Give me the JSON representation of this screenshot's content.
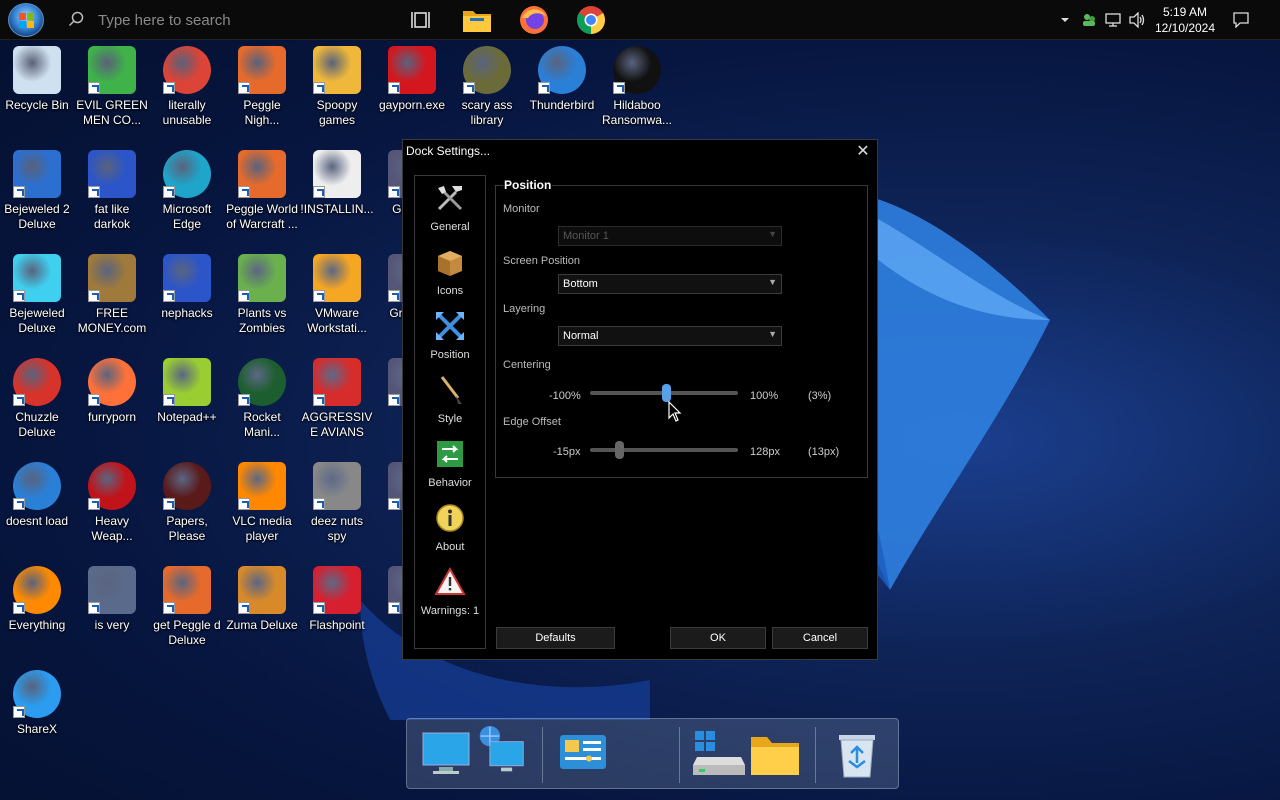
{
  "taskbar": {
    "search_placeholder": "Type here to search",
    "pinned": [
      "task-view-icon",
      "file-explorer-icon",
      "firefox-icon",
      "chrome-icon"
    ],
    "clock_time": "5:19 AM",
    "clock_date": "12/10/2024"
  },
  "desktop": {
    "icons": [
      {
        "label": "Recycle Bin",
        "icon": "recycle-bin-icon"
      },
      {
        "label": "EVIL GREEN MEN CO...",
        "icon": "messenger-icon"
      },
      {
        "label": "literally unusable",
        "icon": "chrome-icon"
      },
      {
        "label": "Peggle Nigh...",
        "icon": "peggle-icon"
      },
      {
        "label": "Spoopy games",
        "icon": "folder-icon"
      },
      {
        "label": "gayporn.exe",
        "icon": "flash-icon"
      },
      {
        "label": "scary ass library",
        "icon": "library-icon"
      },
      {
        "label": "Thunderbird",
        "icon": "thunderbird-icon"
      },
      {
        "label": "Hildaboo Ransomwa...",
        "icon": "yashma-icon"
      },
      {
        "label": "Bejeweled 2 Deluxe",
        "icon": "bejeweled2-icon"
      },
      {
        "label": "fat like darkok",
        "icon": "mpi-icon"
      },
      {
        "label": "Microsoft Edge",
        "icon": "edge-icon"
      },
      {
        "label": "Peggle World of Warcraft ...",
        "icon": "peggle-icon"
      },
      {
        "label": "!INSTALLIN...",
        "icon": "text-file-icon"
      },
      {
        "label": "GI THE",
        "icon": "partial-icon"
      },
      {
        "label": "Bejeweled Deluxe",
        "icon": "diamond-icon"
      },
      {
        "label": "FREE MONEY.com",
        "icon": "money-bag-icon"
      },
      {
        "label": "nephacks",
        "icon": "mpi-icon"
      },
      {
        "label": "Plants vs Zombies",
        "icon": "pvz-icon"
      },
      {
        "label": "VMware Workstati...",
        "icon": "vmware-icon"
      },
      {
        "label": "Gra Part",
        "icon": "partial-icon"
      },
      {
        "label": "Chuzzle Deluxe",
        "icon": "chuzzle-icon"
      },
      {
        "label": "furryporn",
        "icon": "firefox-icon"
      },
      {
        "label": "Notepad++",
        "icon": "notepadpp-icon"
      },
      {
        "label": "Rocket Mani...",
        "icon": "rocket-icon"
      },
      {
        "label": "AGGRESSIVE AVIANS",
        "icon": "angry-birds-icon"
      },
      {
        "label": "Hal",
        "icon": "partial-icon"
      },
      {
        "label": "doesnt load",
        "icon": "thunderbird-icon"
      },
      {
        "label": "Heavy Weap...",
        "icon": "radiation-icon"
      },
      {
        "label": "Papers, Please",
        "icon": "papers-please-icon"
      },
      {
        "label": "VLC media player",
        "icon": "vlc-icon"
      },
      {
        "label": "deez nuts spy",
        "icon": "copies-icon"
      },
      {
        "label": "Ba",
        "icon": "partial-icon"
      },
      {
        "label": "Everything",
        "icon": "search-ring-icon"
      },
      {
        "label": "is very",
        "icon": "mpi-shield-icon"
      },
      {
        "label": "get Peggle d Deluxe",
        "icon": "peggle-icon"
      },
      {
        "label": "Zuma Deluxe",
        "icon": "zuma-icon"
      },
      {
        "label": "Flashpoint",
        "icon": "flashpoint-icon"
      },
      {
        "label": "RD",
        "icon": "partial-icon"
      },
      {
        "label": "ShareX",
        "icon": "sharex-icon"
      }
    ]
  },
  "dialog": {
    "title": "Dock Settings...",
    "sidebar": [
      {
        "label": "General",
        "icon": "tools-icon"
      },
      {
        "label": "Icons",
        "icon": "box-icon"
      },
      {
        "label": "Position",
        "icon": "position-x-icon"
      },
      {
        "label": "Style",
        "icon": "brush-icon"
      },
      {
        "label": "Behavior",
        "icon": "behavior-arrows-icon"
      },
      {
        "label": "About",
        "icon": "info-icon"
      },
      {
        "label": "Warnings: 1",
        "icon": "warning-icon"
      }
    ],
    "group_title": "Position",
    "monitor": {
      "label": "Monitor",
      "value": "Monitor 1"
    },
    "screen_position": {
      "label": "Screen Position",
      "value": "Bottom"
    },
    "layering": {
      "label": "Layering",
      "value": "Normal"
    },
    "centering": {
      "label": "Centering",
      "min": "-100%",
      "max": "100%",
      "current": "(3%)",
      "level": 0.515
    },
    "edge_offset": {
      "label": "Edge Offset",
      "min": "-15px",
      "max": "128px",
      "current": "(13px)",
      "level": 0.196
    },
    "buttons": {
      "defaults": "Defaults",
      "ok": "OK",
      "cancel": "Cancel"
    },
    "accent": "#5aa0e6"
  },
  "dock": {
    "items": [
      "monitor-icon",
      "network-monitor-icon",
      "control-panel-icon",
      "windows-drive-icon",
      "folder-icon",
      "recycle-bin-icon"
    ]
  }
}
